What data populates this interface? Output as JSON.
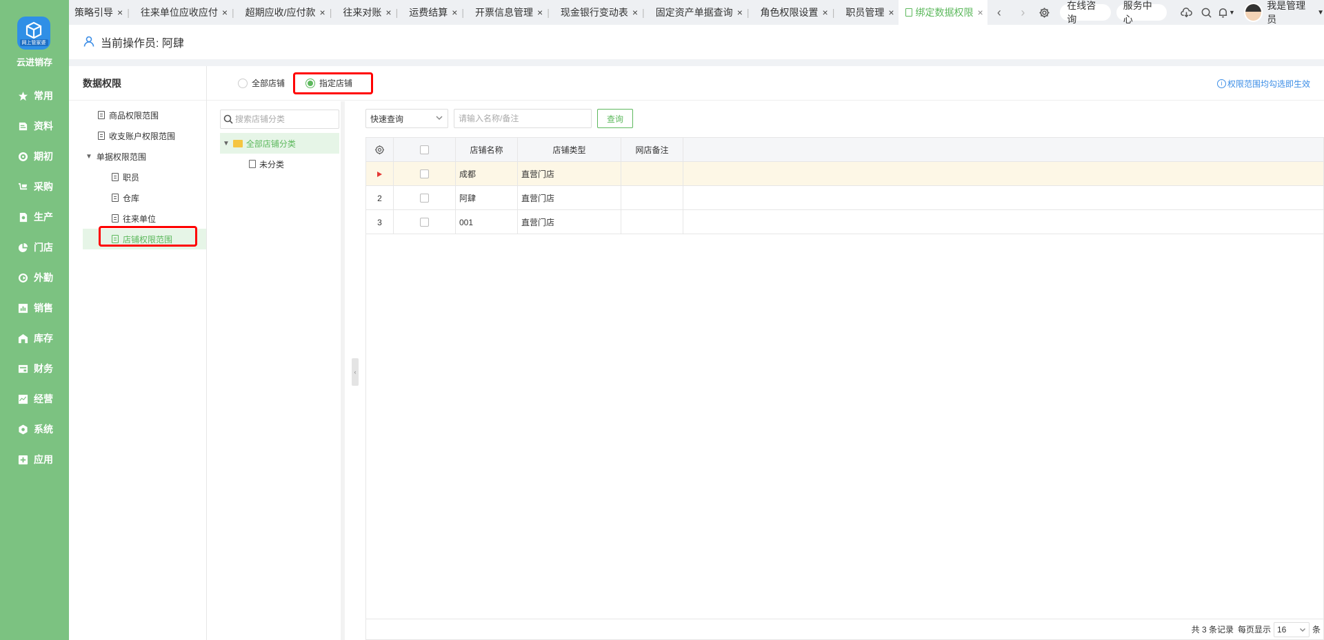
{
  "app": {
    "brand": "云进销存",
    "logo_sub": "网上管家婆"
  },
  "nav": [
    {
      "label": "常用",
      "icon": "star-icon"
    },
    {
      "label": "资料",
      "icon": "file-icon"
    },
    {
      "label": "期初",
      "icon": "period-icon"
    },
    {
      "label": "采购",
      "icon": "cart-icon"
    },
    {
      "label": "生产",
      "icon": "gear-icon"
    },
    {
      "label": "门店",
      "icon": "pie-icon"
    },
    {
      "label": "外勤",
      "icon": "target-icon"
    },
    {
      "label": "销售",
      "icon": "chart-icon"
    },
    {
      "label": "库存",
      "icon": "warehouse-icon"
    },
    {
      "label": "财务",
      "icon": "finance-icon"
    },
    {
      "label": "经营",
      "icon": "trend-icon"
    },
    {
      "label": "系统",
      "icon": "system-icon"
    },
    {
      "label": "应用",
      "icon": "app-icon"
    }
  ],
  "tabs": [
    {
      "label": "策略引导"
    },
    {
      "label": "往来单位应收应付"
    },
    {
      "label": "超期应收/应付款"
    },
    {
      "label": "往来对账"
    },
    {
      "label": "运费结算"
    },
    {
      "label": "开票信息管理"
    },
    {
      "label": "现金银行变动表"
    },
    {
      "label": "固定资产单据查询"
    },
    {
      "label": "角色权限设置"
    },
    {
      "label": "职员管理"
    },
    {
      "label": "绑定数据权限",
      "active": true
    }
  ],
  "topbar": {
    "consult": "在线咨询",
    "service": "服务中心",
    "user": "我是管理员"
  },
  "header": {
    "title": "当前操作员: 阿肆"
  },
  "left": {
    "title": "数据权限",
    "items": [
      {
        "label": "商品权限范围"
      },
      {
        "label": "收支账户权限范围"
      },
      {
        "label": "单据权限范围"
      },
      {
        "label": "职员"
      },
      {
        "label": "仓库"
      },
      {
        "label": "往来单位"
      },
      {
        "label": "店铺权限范围"
      }
    ]
  },
  "radios": {
    "all": "全部店铺",
    "specified": "指定店铺",
    "hint": "权限范围均勾选即生效"
  },
  "category": {
    "search_placeholder": "搜索店铺分类",
    "root": "全部店铺分类",
    "child": "未分类"
  },
  "toolbar": {
    "select": "快速查询",
    "input_placeholder": "请输入名称/备注",
    "query": "查询"
  },
  "grid": {
    "columns": [
      "店铺名称",
      "店铺类型",
      "网店备注"
    ],
    "rows": [
      {
        "no": "",
        "name": "成都",
        "type": "直营门店",
        "remark": ""
      },
      {
        "no": "2",
        "name": "阿肆",
        "type": "直营门店",
        "remark": ""
      },
      {
        "no": "3",
        "name": "001",
        "type": "直营门店",
        "remark": ""
      }
    ],
    "footer": {
      "total": "共 3 条记录",
      "per_page_label": "每页显示",
      "per_page": "16",
      "unit": "条"
    }
  }
}
